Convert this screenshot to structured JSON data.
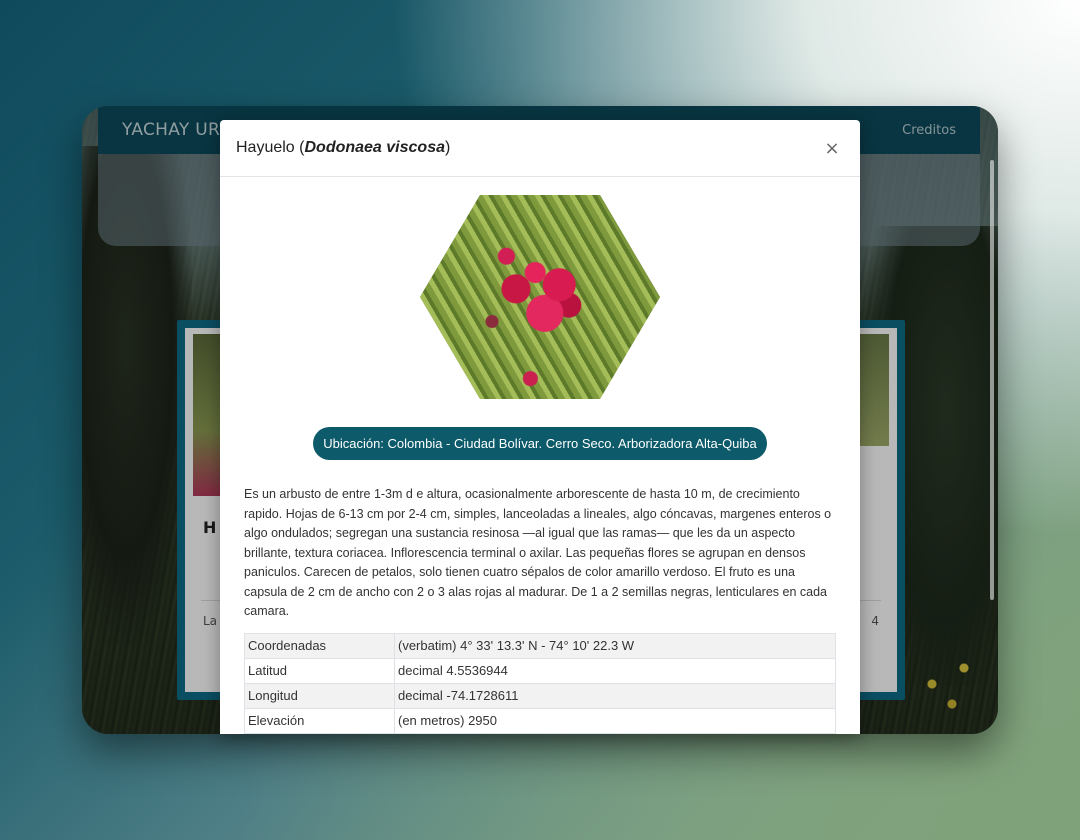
{
  "app": {
    "brand": "YACHAY URC",
    "nav_link": "Creditos"
  },
  "background_card": {
    "heading": "H",
    "footer_left": "La",
    "footer_right": "4"
  },
  "modal": {
    "title_common": "Hayuelo (",
    "title_scientific": "Dodonaea viscosa",
    "title_close_paren": ")",
    "close_symbol": "×",
    "image_alt": "flower",
    "location": "Ubicación: Colombia - Ciudad Bolívar. Cerro Seco. Arborizadora Alta-Quiba",
    "description": "Es un arbusto de entre 1-3m d e altura, ocasionalmente arborescente de hasta 10 m, de crecimiento rapido. Hojas de 6-13 cm por 2-4 cm, simples, lanceoladas a lineales, algo cóncavas, margenes enteros o algo ondulados; segregan una sustancia resinosa —al igual que las ramas— que les da un aspecto brillante, textura coriacea. Inflorescencia terminal o axilar. Las pequeñas flores se agrupan en densos paniculos. Carecen de petalos, solo tienen cuatro sépalos de color amarillo verdoso. El fruto es una capsula de 2 cm de ancho con 2 o 3 alas rojas al madurar. De 1 a 2 semillas negras, lenticulares en cada camara.",
    "table": [
      {
        "key": "Coordenadas",
        "value": "(verbatim) 4° 33' 13.3' N - 74° 10' 22.3 W"
      },
      {
        "key": "Latitud",
        "value": "decimal 4.5536944"
      },
      {
        "key": "Longitud",
        "value": "decimal -74.1728611"
      },
      {
        "key": "Elevación",
        "value": "(en metros) 2950"
      }
    ]
  },
  "colors": {
    "navbar": "#0c4a5a",
    "pill": "#0c5a6a",
    "card_border": "#0f6c88"
  }
}
